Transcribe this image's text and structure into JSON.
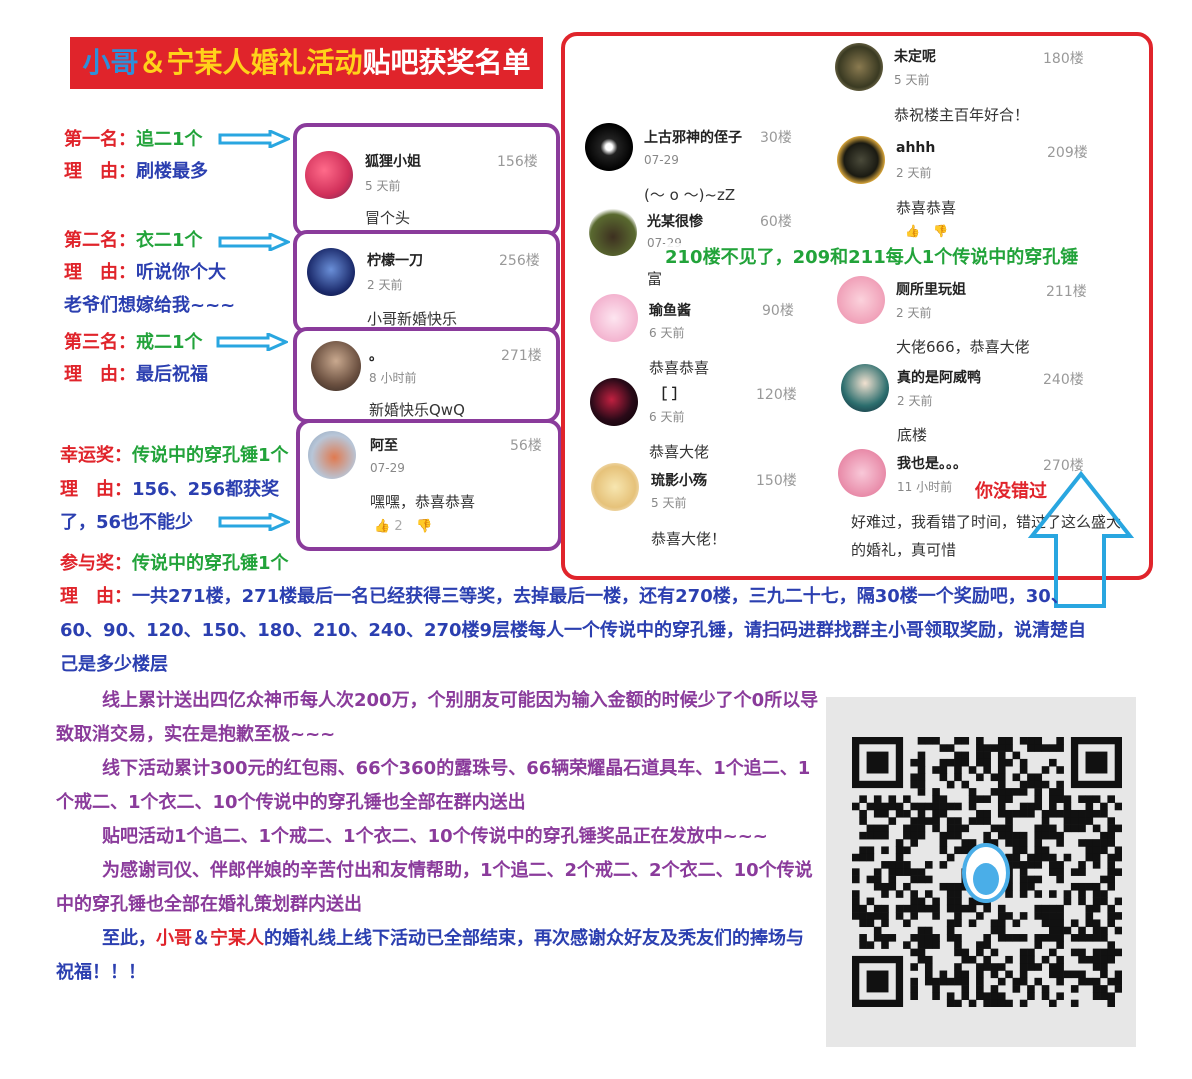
{
  "title": {
    "part1": "小哥",
    "part2": "＆",
    "part3": "宁某人",
    "part4": "婚礼活动",
    "part5": "贴吧获奖名单"
  },
  "colors": {
    "red": "#e0242b",
    "blue": "#2b3fb0",
    "green": "#22a33a",
    "purple": "#8a3b9b"
  },
  "awards": {
    "first": {
      "rank": "第一名：",
      "prize": "追二1个",
      "reason_label": "理　由：",
      "reason": "刷楼最多"
    },
    "second": {
      "rank": "第二名：",
      "prize": "衣二1个",
      "reason_label": "理　由：",
      "reason1": "听说你个大",
      "reason2": "老爷们想嫁给我~~~"
    },
    "third": {
      "rank": "第三名：",
      "prize": "戒二1个",
      "reason_label": "理　由：",
      "reason": "最后祝福"
    },
    "lucky": {
      "rank": "幸运奖：",
      "prize": "传说中的穿孔锤1个",
      "reason_label": "理　由：",
      "reason1": "156、256都获奖",
      "reason2": "了，56也不能少"
    },
    "participation": {
      "rank": "参与奖：",
      "prize": "传说中的穿孔锤1个",
      "reason_label": "理　由：",
      "reason": "一共271楼，271楼最后一名已经获得三等奖，去掉最后一楼，还有270楼，三九二十七，隔30楼一个奖励吧，30、60、90、120、150、180、210、240、270楼9层楼每人一个传说中的穿孔锤，请扫码进群找群主小哥领取奖励，说清楚自己是多少楼层"
    }
  },
  "left_posts": [
    {
      "name": "狐狸小姐",
      "time": "5 天前",
      "floor": "156楼",
      "msg": "冒个头"
    },
    {
      "name": "柠檬一刀",
      "time": "2 天前",
      "floor": "256楼",
      "msg": "小哥新婚快乐"
    },
    {
      "name": "。",
      "time": "8 小时前",
      "floor": "271楼",
      "msg": "新婚快乐QwQ"
    },
    {
      "name": "阿至",
      "time": "07-29",
      "floor": "56楼",
      "msg": "嘿嘿，恭喜恭喜",
      "likes": "2"
    }
  ],
  "right_posts_left": [
    {
      "name": "上古邪神的侄子",
      "time": "07-29",
      "floor": "30楼",
      "msg": "(～ o ～)~zZ"
    },
    {
      "name": "光某很惨",
      "time": "07-29",
      "floor": "60楼",
      "msg": "富"
    },
    {
      "name": "瑜鱼酱",
      "time": "6 天前",
      "floor": "90楼",
      "msg": "恭喜恭喜"
    },
    {
      "name": "［ ］",
      "time": "6 天前",
      "floor": "120楼",
      "msg": "恭喜大佬"
    },
    {
      "name": "琉影小殇",
      "time": "5 天前",
      "floor": "150楼",
      "msg": "恭喜大佬！"
    }
  ],
  "right_posts_right": [
    {
      "name": "未定呢",
      "time": "5 天前",
      "floor": "180楼",
      "msg": "恭祝楼主百年好合！"
    },
    {
      "name": "ahhh",
      "time": "2 天前",
      "floor": "209楼",
      "msg": "恭喜恭喜"
    },
    {
      "name": "厕所里玩姐",
      "time": "2 天前",
      "floor": "211楼",
      "msg": "大佬666，恭喜大佬"
    },
    {
      "name": "真的是阿威鸭",
      "time": "2 天前",
      "floor": "240楼",
      "msg": "底楼"
    },
    {
      "name": "我也是。。。",
      "time": "11 小时前",
      "floor": "270楼",
      "msg": "好难过，我看错了时间，错过了这么盛大的婚礼，真可惜"
    }
  ],
  "note_210": "210楼不见了，209和211每人1个传说中的穿孔锤",
  "note_270": "你没错过",
  "paragraphs": {
    "p1": "线上累计送出四亿众神币每人次200万，个别朋友可能因为输入金额的时候少了个0所以导致取消交易，实在是抱歉至极~~~",
    "p2": "线下活动累计300元的红包雨、66个360的露珠号、66辆荣耀晶石道具车、1个追二、1个戒二、1个衣二、10个传说中的穿孔锤也全部在群内送出",
    "p3": "贴吧活动1个追二、1个戒二、1个衣二、10个传说中的穿孔锤奖品正在发放中~~~",
    "p4": "为感谢司仪、伴郎伴娘的辛苦付出和友情帮助，1个追二、2个戒二、2个衣二、10个传说中的穿孔锤也全部在婚礼策划群内送出",
    "p5_a": "至此，",
    "p5_b": "小哥",
    "p5_c": "＆",
    "p5_d": "宁某人",
    "p5_e": "的婚礼线上线下活动已全部结束，再次感谢众好友及秃友们的捧场与祝福！！！"
  },
  "qr": {
    "icon": "qq-penguin-icon"
  }
}
